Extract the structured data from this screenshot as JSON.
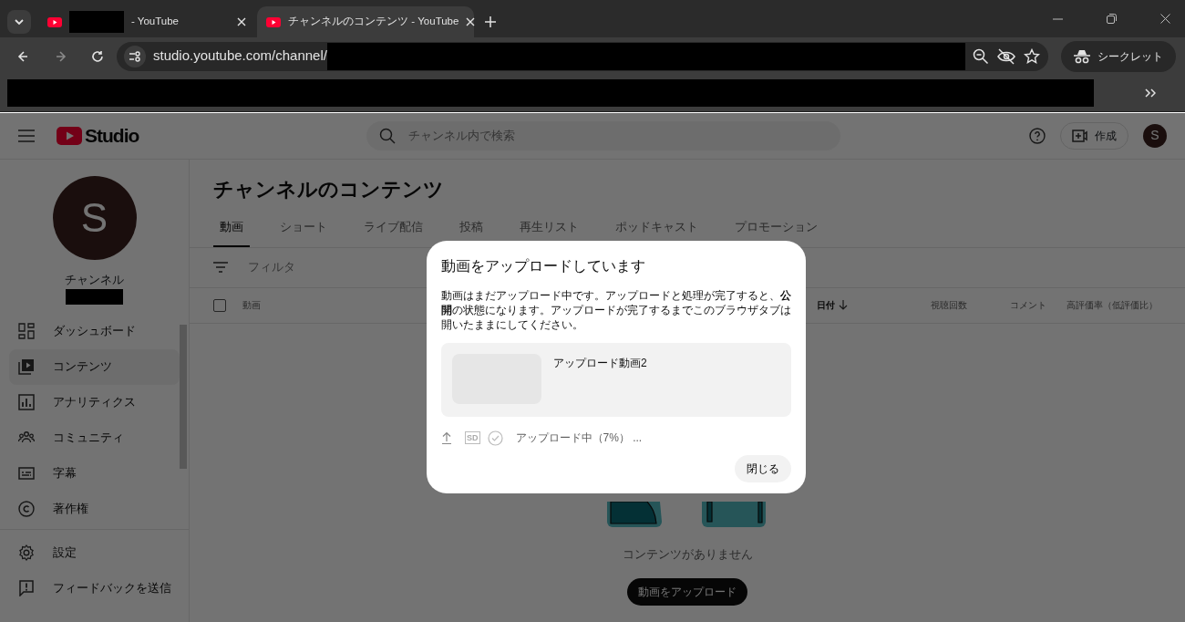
{
  "browser": {
    "tabs": [
      {
        "title": "- YouTube",
        "redacted_prefix": true,
        "selected": false
      },
      {
        "title": "チャンネルのコンテンツ - YouTube",
        "redacted_prefix": false,
        "selected": true
      }
    ],
    "url": "studio.youtube.com/channel/",
    "url_redacted": true,
    "incognito_label": "シークレット",
    "bookmarks_redacted": true
  },
  "header": {
    "logo_text": "Studio",
    "search_placeholder": "チャンネル内で検索",
    "create_label": "作成",
    "avatar_letter": "S"
  },
  "sidebar": {
    "avatar_letter": "S",
    "channel_label": "チャンネル",
    "channel_name_redacted": true,
    "items": [
      {
        "label": "ダッシュボード",
        "selected": false
      },
      {
        "label": "コンテンツ",
        "selected": true
      },
      {
        "label": "アナリティクス",
        "selected": false
      },
      {
        "label": "コミュニティ",
        "selected": false
      },
      {
        "label": "字幕",
        "selected": false
      },
      {
        "label": "著作権",
        "selected": false
      }
    ],
    "footer_items": [
      {
        "label": "設定"
      },
      {
        "label": "フィードバックを送信"
      }
    ]
  },
  "content": {
    "title": "チャンネルのコンテンツ",
    "tabs": [
      {
        "label": "動画",
        "selected": true
      },
      {
        "label": "ショート",
        "selected": false
      },
      {
        "label": "ライブ配信",
        "selected": false
      },
      {
        "label": "投稿",
        "selected": false
      },
      {
        "label": "再生リスト",
        "selected": false
      },
      {
        "label": "ポッドキャスト",
        "selected": false
      },
      {
        "label": "プロモーション",
        "selected": false
      }
    ],
    "filter_label": "フィルタ",
    "select_all_checked": false,
    "columns": [
      {
        "label": "動画",
        "sorted": false
      },
      {
        "label": "日付",
        "sorted": true
      },
      {
        "label": "視聴回数",
        "sorted": false
      },
      {
        "label": "コメント",
        "sorted": false
      },
      {
        "label": "高評価率（低評価比）",
        "sorted": false
      }
    ],
    "empty_text": "コンテンツがありません",
    "upload_button": "動画をアップロード"
  },
  "dialog": {
    "title": "動画をアップロードしています",
    "message": "動画はまだアップロード中です。アップロードと処理が完了すると、**公開**の状態になります。アップロードが完了するまでこのブラウザタブは開いたままにしてください。",
    "file_name": "アップロード動画2",
    "sd_badge": "SD",
    "status": "アップロード中（7%） ...",
    "close_button": "閉じる"
  }
}
